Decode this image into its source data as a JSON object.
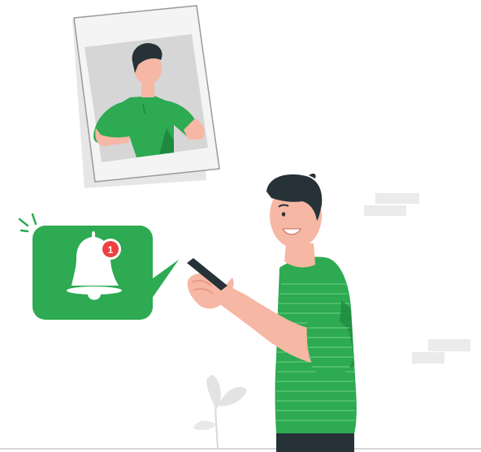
{
  "colors": {
    "brand_green": "#2daa52",
    "green_dark": "#1f8a3f",
    "skin": "#f6b7a4",
    "skin_shadow": "#e89b86",
    "hair": "#263238",
    "badge_red": "#ef4040",
    "photo_bg": "#d6d6d6",
    "frame": "#f4f4f4",
    "brick": "#ebebeb",
    "leaf": "#e3e3e3"
  },
  "notification": {
    "icon": "bell-icon",
    "badge_count": "1"
  },
  "icons": [
    "bell-icon",
    "phone-icon",
    "plant-icon",
    "photo-frame-icon",
    "alert-lines-icon"
  ]
}
